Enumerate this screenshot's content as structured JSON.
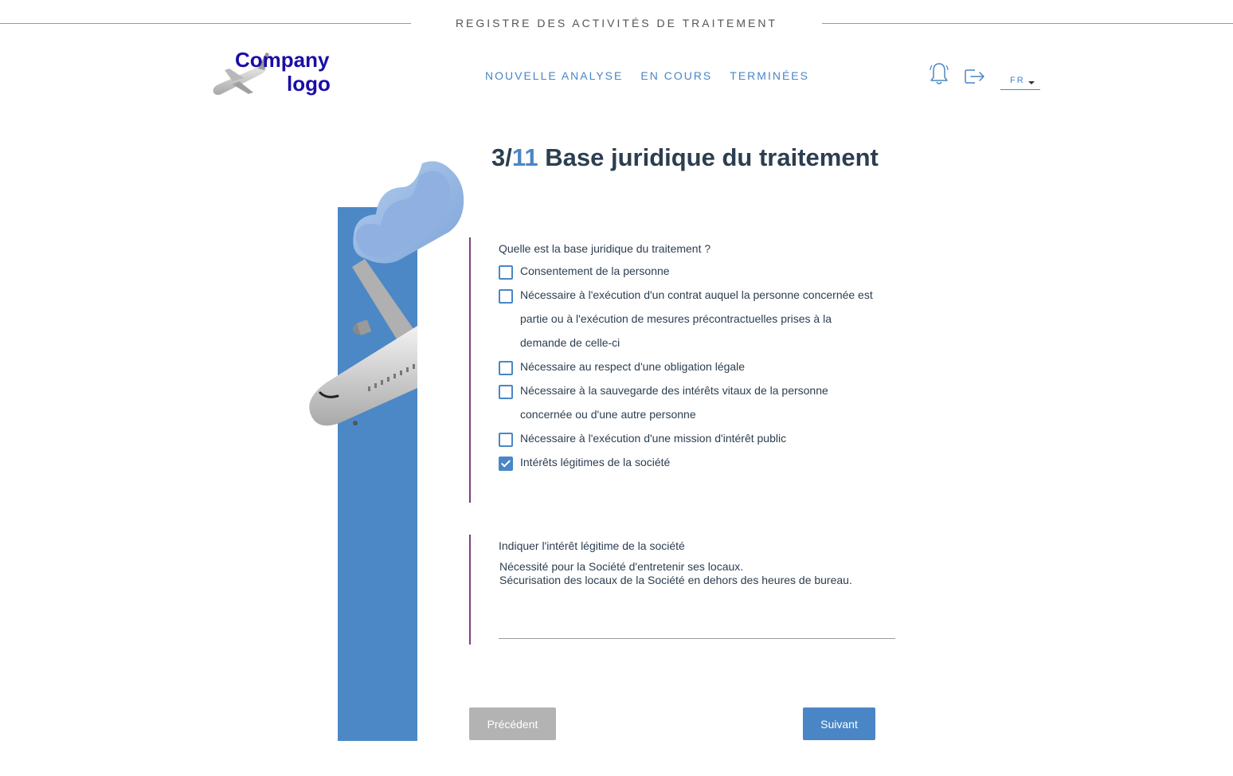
{
  "header": {
    "app_title": "REGISTRE DES ACTIVITÉS DE TRAITEMENT",
    "logo_text_line1": "Company",
    "logo_text_line2": "logo",
    "nav": [
      "NOUVELLE ANALYSE",
      "EN COURS",
      "TERMINÉES"
    ],
    "language": "FR",
    "icons": [
      "bell-icon",
      "logout-icon",
      "chevron-down-icon"
    ]
  },
  "step": {
    "current": "3/",
    "total": "11",
    "title": " Base juridique du traitement"
  },
  "question1": {
    "label": "Quelle est la base juridique du traitement ?",
    "options": [
      {
        "label": "Consentement de la personne",
        "checked": false
      },
      {
        "label": "Nécessaire à l'exécution d'un contrat auquel la personne concernée est partie ou à l'exécution de mesures précontractuelles prises à la demande de celle-ci",
        "checked": false
      },
      {
        "label": "Nécessaire au respect d'une obligation légale",
        "checked": false
      },
      {
        "label": "Nécessaire à la sauvegarde des intérêts vitaux de la personne concernée ou d'une autre personne",
        "checked": false
      },
      {
        "label": "Nécessaire à l'exécution d'une mission d'intérêt public",
        "checked": false
      },
      {
        "label": "Intérêts légitimes de la société",
        "checked": true
      }
    ]
  },
  "question2": {
    "label": "Indiquer l'intérêt légitime de la société",
    "value": "Nécessité pour la Société d'entretenir ses locaux.\nSécurisation des locaux de la Société en dehors des heures de bureau."
  },
  "buttons": {
    "previous": "Précédent",
    "next": "Suivant"
  },
  "colors": {
    "accent": "#4a86c5",
    "heading": "#2c3e50",
    "logo": "#1a0da8",
    "section_bar": "#7b3f7d",
    "disabled_button": "#b3b3b3"
  }
}
